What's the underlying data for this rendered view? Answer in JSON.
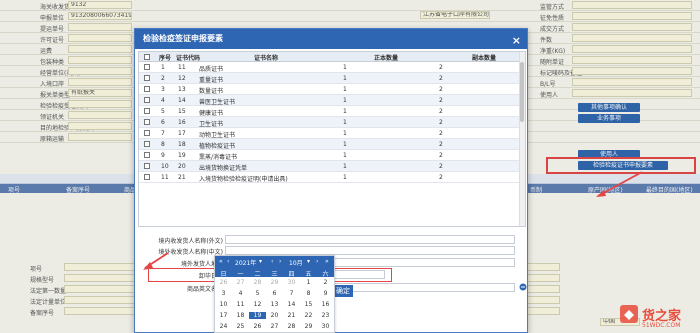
{
  "background": {
    "rows": [
      {
        "label": "海关收发货人",
        "value": "9132"
      },
      {
        "label": "申报单位",
        "value": "91320800660734198"
      },
      {
        "label": "提运单号",
        "value": ""
      },
      {
        "label": "许可证号",
        "value": ""
      },
      {
        "label": "运费",
        "value": ""
      },
      {
        "label": "包装种类",
        "value": ""
      },
      {
        "label": "经营单位(英文)",
        "value": ""
      },
      {
        "label": "入境口岸",
        "value": ""
      },
      {
        "label": "报关单类型",
        "value": "有纸报关"
      },
      {
        "label": "检验检疫受理机关",
        "value": ""
      },
      {
        "label": "领证机关",
        "value": ""
      },
      {
        "label": "目的地检验检疫机关",
        "value": ""
      },
      {
        "label": "原箱运输",
        "value": ""
      }
    ],
    "left_values": [
      "消费使用单位",
      "申报单位",
      "提运单号",
      "许可证号"
    ],
    "right_labels": [
      "监管方式",
      "征免性质",
      "成交方式",
      "件数",
      "净重(KG)",
      "随附单证",
      "标记唛码及备注",
      "B/L号",
      "使用人"
    ],
    "company": "江苏省电子口岸有限公司",
    "buttons": {
      "other_matters": "其他事项确认",
      "business_matters": "业务事项",
      "user": "使用人",
      "inspection_req": "检验检疫证书申报要素"
    },
    "table_headers": [
      "项号",
      "备案序号",
      "商品编号",
      "商品名称",
      "规格型号",
      "成交数量",
      "成交单位",
      "单价",
      "总价",
      "币制",
      "原产国(地区)",
      "最终目的国(地区)"
    ],
    "bottom_labels": [
      "项号",
      "商品名称",
      "规格型号",
      "成交数量",
      "法定第一数量",
      "法定第二数量",
      "法定计量单位",
      "征免方式",
      "备案序号",
      "原产国(地区)"
    ],
    "bottom_tag": "中国"
  },
  "dialog": {
    "title": "检验检疫签证申报要素",
    "close_icon": "×",
    "grid": {
      "headers": {
        "index": "序号",
        "code": "证书代码",
        "name": "证书名称",
        "original": "正本数量",
        "copy": "副本数量"
      },
      "rows": [
        {
          "index": "1",
          "code": "11",
          "name": "品质证书",
          "original": "1",
          "copy": "2"
        },
        {
          "index": "2",
          "code": "12",
          "name": "重量证书",
          "original": "1",
          "copy": "2"
        },
        {
          "index": "3",
          "code": "13",
          "name": "数量证书",
          "original": "1",
          "copy": "2"
        },
        {
          "index": "4",
          "code": "14",
          "name": "兽医卫生证书",
          "original": "1",
          "copy": "2"
        },
        {
          "index": "5",
          "code": "15",
          "name": "健康证书",
          "original": "1",
          "copy": "2"
        },
        {
          "index": "6",
          "code": "16",
          "name": "卫生证书",
          "original": "1",
          "copy": "2"
        },
        {
          "index": "7",
          "code": "17",
          "name": "动物卫生证书",
          "original": "1",
          "copy": "2"
        },
        {
          "index": "8",
          "code": "18",
          "name": "植物检疫证书",
          "original": "1",
          "copy": "2"
        },
        {
          "index": "9",
          "code": "19",
          "name": "熏蒸/消毒证书",
          "original": "1",
          "copy": "2"
        },
        {
          "index": "10",
          "code": "20",
          "name": "出境货物换证凭单",
          "original": "1",
          "copy": "2"
        },
        {
          "index": "11",
          "code": "21",
          "name": "入境货物检验检疫证明(申请出具)",
          "original": "1",
          "copy": "2"
        }
      ]
    },
    "fields": {
      "consignee_foreign": {
        "label": "境内收发货人名称(外文)",
        "placeholder": ""
      },
      "overseas_cn": {
        "label": "境外收发货人名称(中文)",
        "placeholder": ""
      },
      "overseas_addr": {
        "label": "境外发货人地址",
        "placeholder": "发货人地址"
      },
      "unload_date": {
        "label": "卸毕日期",
        "placeholder": "请选择日期"
      },
      "goods_en": {
        "label": "商品英文名称",
        "placeholder": ""
      }
    },
    "ok_button": "确定"
  },
  "calendar": {
    "year": "2021年",
    "month": "10月",
    "weekdays": [
      "日",
      "一",
      "二",
      "三",
      "四",
      "五",
      "六"
    ],
    "weeks": [
      [
        "26",
        "27",
        "28",
        "29",
        "30",
        "1",
        "2"
      ],
      [
        "3",
        "4",
        "5",
        "6",
        "7",
        "8",
        "9"
      ],
      [
        "10",
        "11",
        "12",
        "13",
        "14",
        "15",
        "16"
      ],
      [
        "17",
        "18",
        "19",
        "20",
        "21",
        "22",
        "23"
      ],
      [
        "24",
        "25",
        "26",
        "27",
        "28",
        "29",
        "30"
      ]
    ],
    "selected_day": "19"
  },
  "watermark": {
    "brand": "货之家",
    "sub": "51WDC.COM"
  },
  "colors": {
    "primary": "#2f66b3",
    "highlight": "#e64545",
    "table_head": "#5c7fb3"
  }
}
